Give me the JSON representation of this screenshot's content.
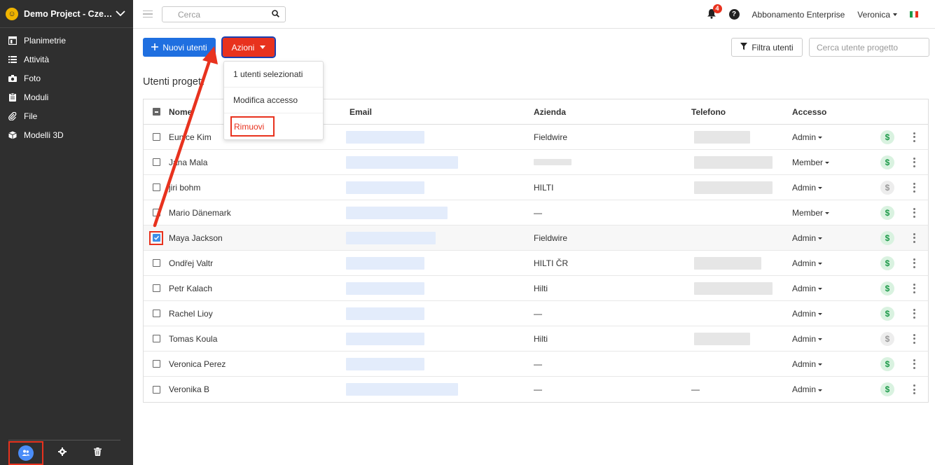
{
  "sidebar": {
    "project": "Demo Project - Cze…",
    "nav": [
      {
        "label": "Planimetrie",
        "icon": "floorplan-icon"
      },
      {
        "label": "Attività",
        "icon": "list-icon"
      },
      {
        "label": "Foto",
        "icon": "camera-icon"
      },
      {
        "label": "Moduli",
        "icon": "clipboard-icon"
      },
      {
        "label": "File",
        "icon": "paperclip-icon"
      },
      {
        "label": "Modelli 3D",
        "icon": "cube-icon"
      }
    ]
  },
  "topbar": {
    "search_placeholder": "Cerca",
    "notification_count": "4",
    "help": "?",
    "plan": "Abbonamento Enterprise",
    "user": "Veronica"
  },
  "toolbar": {
    "new_users": "Nuovi utenti",
    "actions": "Azioni",
    "filter_users": "Filtra utenti",
    "search_users_placeholder": "Cerca utente progetto"
  },
  "section_title": "Utenti progett",
  "dropdown": {
    "selected_count": "1 utenti selezionati",
    "edit_access": "Modifica accesso",
    "remove": "Rimuovi"
  },
  "table": {
    "headers": {
      "name": "Nome",
      "email": "Email",
      "company": "Azienda",
      "phone": "Telefono",
      "access": "Accesso"
    },
    "rows": [
      {
        "name": "Eunice Kim",
        "company": "Fieldwire",
        "phone": "",
        "access": "Admin",
        "billing": true,
        "checked": false
      },
      {
        "name": "Jana Mala",
        "company": "",
        "phone": "",
        "access": "Member",
        "billing": true,
        "checked": false
      },
      {
        "name": "jiri bohm",
        "company": "HILTI",
        "phone": "",
        "access": "Admin",
        "billing": false,
        "checked": false
      },
      {
        "name": "Mario Dänemark",
        "company": "—",
        "phone": "",
        "access": "Member",
        "billing": true,
        "checked": false
      },
      {
        "name": "Maya Jackson",
        "company": "Fieldwire",
        "phone": "",
        "access": "Admin",
        "billing": true,
        "checked": true
      },
      {
        "name": "Ondřej Valtr",
        "company": "HILTI ČR",
        "phone": "",
        "access": "Admin",
        "billing": true,
        "checked": false
      },
      {
        "name": "Petr Kalach",
        "company": "Hilti",
        "phone": "",
        "access": "Admin",
        "billing": true,
        "checked": false
      },
      {
        "name": "Rachel Lioy",
        "company": "—",
        "phone": "",
        "access": "Admin",
        "billing": true,
        "checked": false
      },
      {
        "name": "Tomas Koula",
        "company": "Hilti",
        "phone": "",
        "access": "Admin",
        "billing": false,
        "checked": false
      },
      {
        "name": "Veronica Perez",
        "company": "—",
        "phone": "",
        "access": "Admin",
        "billing": true,
        "checked": false
      },
      {
        "name": "Veronika B",
        "company": "—",
        "phone": "—",
        "access": "Admin",
        "billing": true,
        "checked": false
      }
    ]
  },
  "colors": {
    "accent_blue": "#1f6fe0",
    "accent_red": "#e8321e",
    "sidebar_bg": "#2f2f2f",
    "billing_green": "#1e9a4a"
  }
}
